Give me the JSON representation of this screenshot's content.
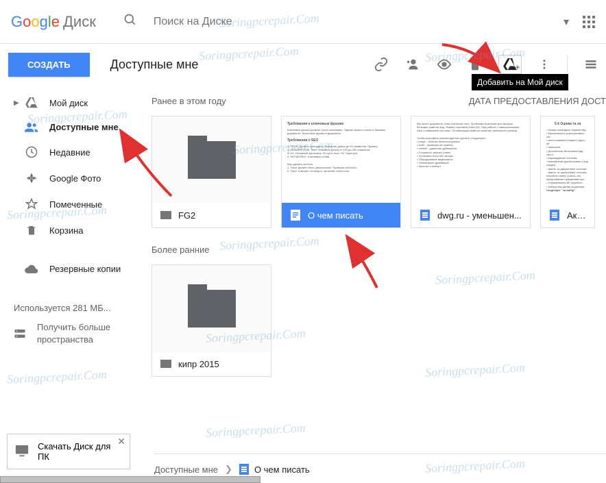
{
  "logo": {
    "suffix": "Диск"
  },
  "search": {
    "placeholder": "Поиск на Диске"
  },
  "toolbar": {
    "create": "СОЗДАТЬ",
    "title": "Доступные мне",
    "tooltip": "Добавить на Мой диск"
  },
  "sidebar": {
    "items": [
      {
        "label": "Мой диск"
      },
      {
        "label": "Доступные мне"
      },
      {
        "label": "Недавние"
      },
      {
        "label": "Google Фото"
      },
      {
        "label": "Помеченные"
      },
      {
        "label": "Корзина"
      }
    ],
    "backup": "Резервные копии",
    "storage": "Используется 281 МБ...",
    "more_space": "Получить больше пространства"
  },
  "main": {
    "date_header": "ДАТА ПРЕДОСТАВЛЕНИЯ ДОСТ",
    "sections": [
      {
        "title": "Ранее в этом году",
        "files": [
          {
            "name": "FG2",
            "type": "folder"
          },
          {
            "name": "О чем писать",
            "type": "doc",
            "selected": true
          },
          {
            "name": "dwg.ru - уменьшен...",
            "type": "doc"
          },
          {
            "name": "Акт перер",
            "type": "doc"
          }
        ]
      },
      {
        "title": "Более ранние",
        "files": [
          {
            "name": "кипр 2015",
            "type": "folder"
          }
        ]
      }
    ]
  },
  "breadcrumb": {
    "root": "Доступные мне",
    "current": "О чем писать"
  },
  "promo": {
    "text": "Скачать Диск для ПК"
  },
  "watermark": "Soringpcrepair.Com"
}
